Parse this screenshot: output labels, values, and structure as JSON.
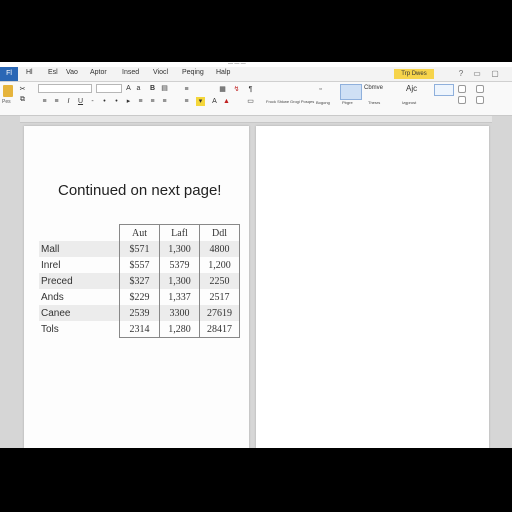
{
  "window": {
    "title": "— — —"
  },
  "menu": {
    "file": "Fl",
    "items": [
      "Hl",
      "Esl",
      "Vao",
      "Aptor",
      "Insed",
      "Viocl",
      "Peqing",
      "Halp"
    ],
    "tell_me": "Trp Dwes"
  },
  "ribbon": {
    "font_name": "",
    "font_size": "",
    "paste_label": "Pes",
    "styles": [
      {
        "name": "Frock Shkwe"
      },
      {
        "name": "Grogi Posqes"
      },
      {
        "name": "Bogong"
      },
      {
        "name": "Pbgre"
      },
      {
        "name": "Thesrs"
      },
      {
        "name": "Izgprost"
      }
    ],
    "style_heads": [
      "Cbmve",
      "Ajc"
    ]
  },
  "document": {
    "heading": "Continued on next page!",
    "table": {
      "columns": [
        "",
        "Aut",
        "Lafl",
        "Ddl"
      ],
      "rows": [
        {
          "label": "Mall",
          "values": [
            "$571",
            "1,300",
            "4800"
          ]
        },
        {
          "label": "Inrel",
          "values": [
            "$557",
            "5379",
            "1,200"
          ]
        },
        {
          "label": "Preced",
          "values": [
            "$327",
            "1,300",
            "2250"
          ]
        },
        {
          "label": "Ands",
          "values": [
            "$229",
            "1,337",
            "2517"
          ]
        },
        {
          "label": "Canee",
          "values": [
            "2539",
            "3300",
            "27619"
          ]
        },
        {
          "label": "Tols",
          "values": [
            "2314",
            "1,280",
            "28417"
          ]
        }
      ]
    }
  },
  "colors": {
    "file_tab": "#2a67b5",
    "tell_me": "#f6d44b",
    "highlight": "#f4d63a"
  }
}
